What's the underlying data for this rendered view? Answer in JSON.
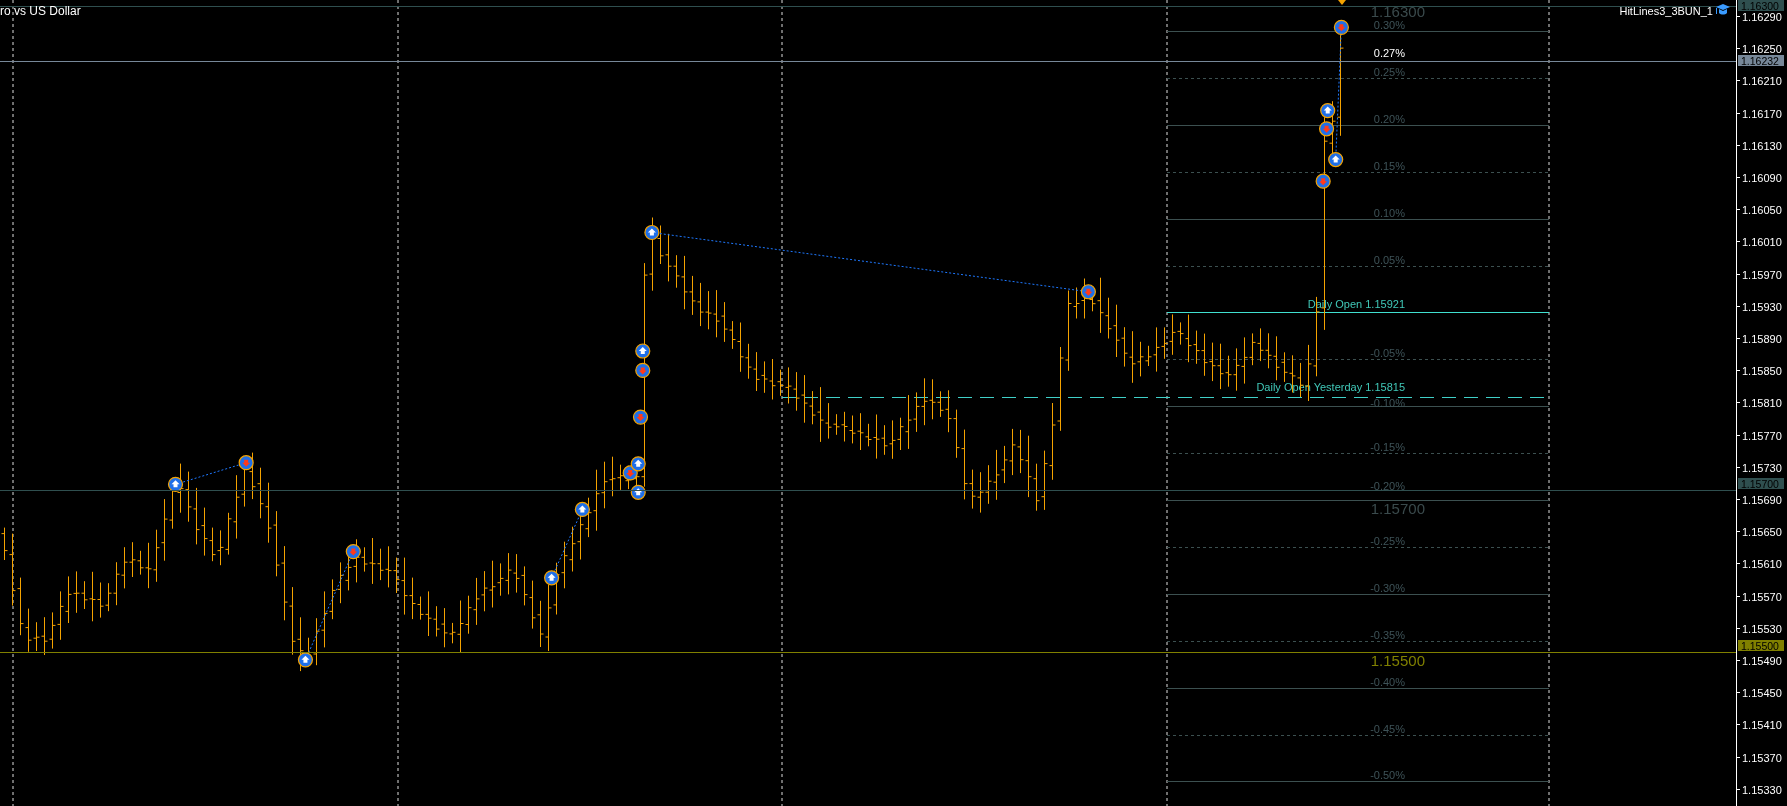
{
  "chart": {
    "symbol_title": "ro vs US Dollar",
    "indicator_label": "HitLines3_3BUN_1"
  },
  "price_axis": {
    "ticks": [
      "1.16290",
      "1.16250",
      "1.16210",
      "1.16170",
      "1.16130",
      "1.16090",
      "1.16050",
      "1.16010",
      "1.15970",
      "1.15930",
      "1.15890",
      "1.15850",
      "1.15810",
      "1.15770",
      "1.15730",
      "1.15690",
      "1.15650",
      "1.15610",
      "1.15570",
      "1.15530",
      "1.15490",
      "1.15450",
      "1.15410",
      "1.15370",
      "1.15330"
    ]
  },
  "price_lines": [
    {
      "kind": "round",
      "tag": "1.16300",
      "label": "1.16300",
      "color": "#2f4f4f"
    },
    {
      "kind": "current",
      "tag": "1.16232",
      "label": "0.27%",
      "color": "#778899"
    },
    {
      "kind": "round",
      "tag": "1.15700",
      "label": "1.15700",
      "color": "#2f4f4f"
    },
    {
      "kind": "round",
      "tag": "1.15500",
      "label": "1.15500",
      "color": "#808000"
    }
  ],
  "percent_levels": [
    {
      "label": "0.30%",
      "kind": "solid"
    },
    {
      "label": "0.25%",
      "kind": "dashed"
    },
    {
      "label": "0.20%",
      "kind": "solid"
    },
    {
      "label": "0.15%",
      "kind": "dashed"
    },
    {
      "label": "0.10%",
      "kind": "solid"
    },
    {
      "label": "0.05%",
      "kind": "dashed"
    },
    {
      "label": "-0.05%",
      "kind": "dashed"
    },
    {
      "label": "-0.10%",
      "kind": "solid"
    },
    {
      "label": "-0.15%",
      "kind": "dashed"
    },
    {
      "label": "-0.20%",
      "kind": "solid"
    },
    {
      "label": "-0.25%",
      "kind": "dashed"
    },
    {
      "label": "-0.30%",
      "kind": "solid"
    },
    {
      "label": "-0.35%",
      "kind": "dashed"
    },
    {
      "label": "-0.40%",
      "kind": "solid"
    },
    {
      "label": "-0.45%",
      "kind": "dashed"
    },
    {
      "label": "-0.50%",
      "kind": "solid"
    }
  ],
  "daily_open": {
    "label": "Daily Open 1.15921"
  },
  "daily_open_yesterday": {
    "label": "Daily Open Yesterday 1.15815"
  }
}
